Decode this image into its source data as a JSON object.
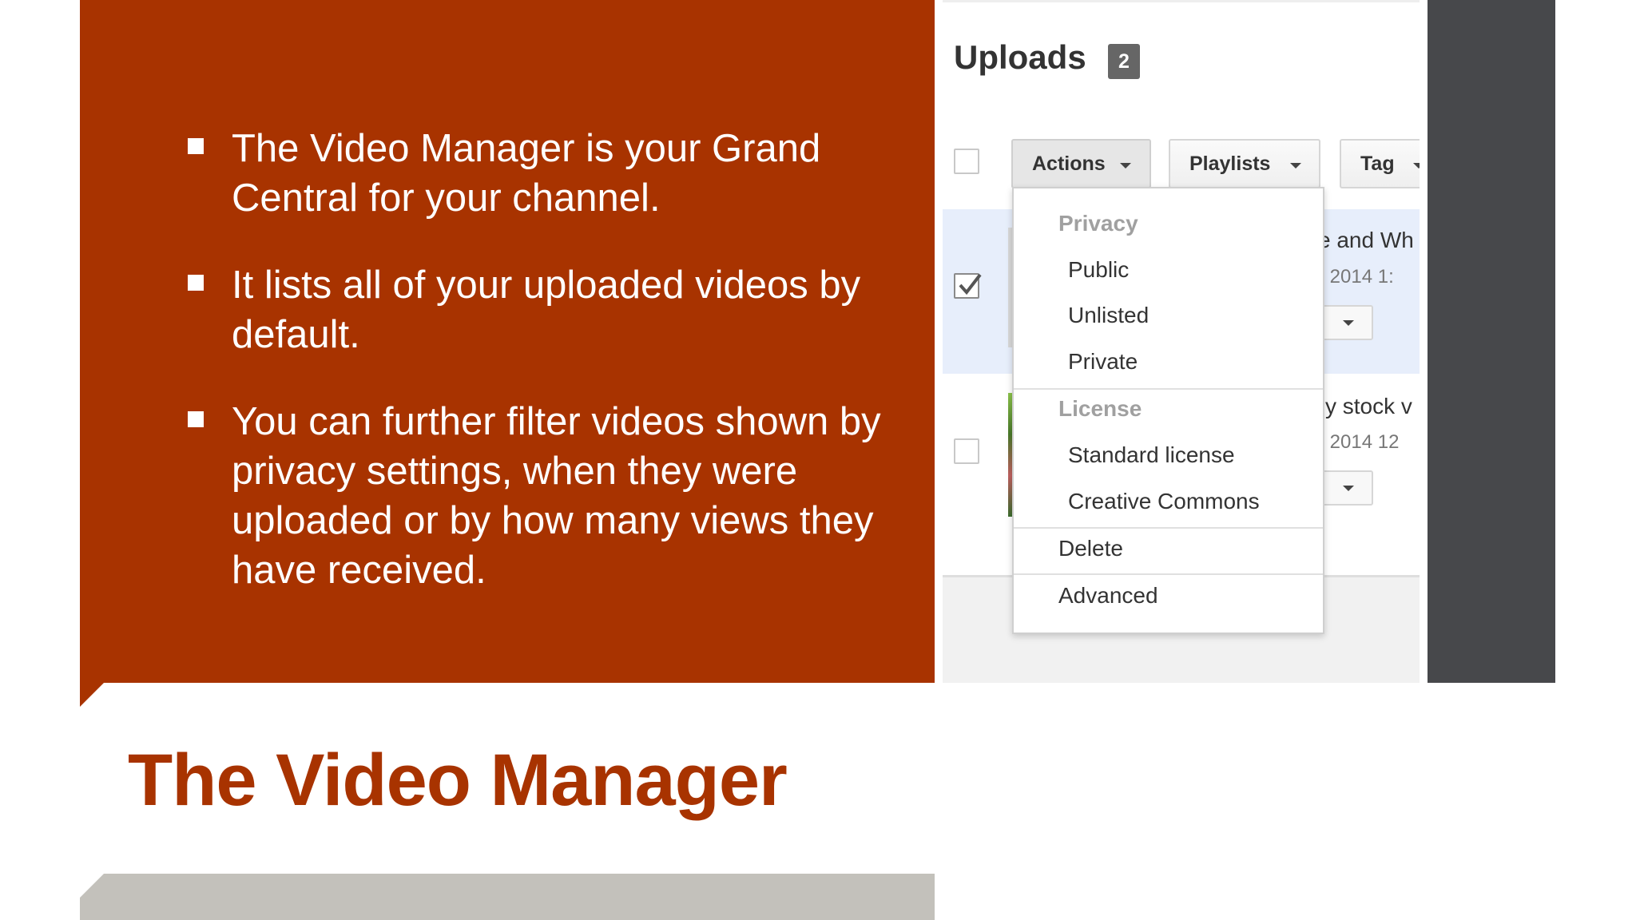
{
  "slide": {
    "title": "The Video Manager",
    "bullets": [
      "The Video Manager is your Grand Central for your channel.",
      "It lists all of your uploaded videos by default.",
      "You can further filter videos shown by privacy settings, when they were uploaded or by how many views they have received."
    ]
  },
  "uploads": {
    "title": "Uploads",
    "count": "2",
    "toolbar": {
      "actions_label": "Actions",
      "playlists_label": "Playlists",
      "tag_label": "Tag"
    },
    "rows": [
      {
        "title_fragment": "e and Wh",
        "date_fragment": "1, 2014 1:",
        "checked": true
      },
      {
        "title_fragment": "fly stock v",
        "date_fragment": "1, 2014 12",
        "checked": false
      }
    ],
    "menu": {
      "privacy_header": "Privacy",
      "privacy_items": [
        "Public",
        "Unlisted",
        "Private"
      ],
      "license_header": "License",
      "license_items": [
        "Standard license",
        "Creative Commons"
      ],
      "delete_label": "Delete",
      "advanced_label": "Advanced"
    }
  },
  "colors": {
    "accent": "#a83300",
    "dark_strip": "#47484b",
    "gray_bar": "#c3c1bb"
  }
}
